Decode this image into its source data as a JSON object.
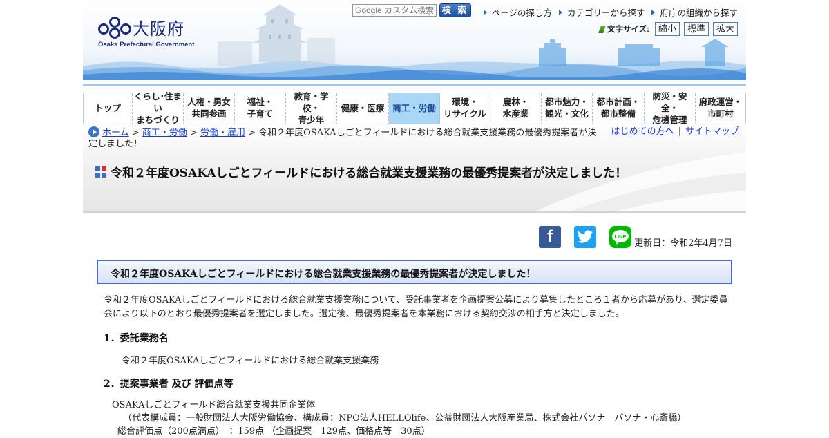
{
  "header": {
    "logo_text": "大阪府",
    "logo_sub": "Osaka Prefectural Government",
    "search_placeholder": "Google カスタム検索",
    "search_button": "検 索",
    "top_links": [
      "ページの探し方",
      "カテゴリーから探す",
      "府庁の組織から探す"
    ],
    "fontsize_label": "文字サイズ:",
    "fontsize_buttons": [
      "縮小",
      "標準",
      "拡大"
    ]
  },
  "nav": [
    {
      "label": "トップ",
      "active": false
    },
    {
      "label": "くらし･住まい\nまちづくり",
      "active": false
    },
    {
      "label": "人権・男女\n共同参画",
      "active": false
    },
    {
      "label": "福祉・\n子育て",
      "active": false
    },
    {
      "label": "教育・学校・\n青少年",
      "active": false
    },
    {
      "label": "健康・医療",
      "active": false
    },
    {
      "label": "商工・労働",
      "active": true
    },
    {
      "label": "環境・\nリサイクル",
      "active": false
    },
    {
      "label": "農林・\n水産業",
      "active": false
    },
    {
      "label": "都市魅力・\n観光・文化",
      "active": false
    },
    {
      "label": "都市計画・\n都市整備",
      "active": false
    },
    {
      "label": "防災・安全・\n危機管理",
      "active": false
    },
    {
      "label": "府政運営・\n市町村",
      "active": false
    }
  ],
  "breadcrumb": {
    "items": [
      "ホーム",
      "商工・労働",
      "労働・雇用"
    ],
    "current": "令和２年度OSAKAしごとフィールドにおける総合就業支援業務の最優秀提案者が決定しました！"
  },
  "util_links": [
    "はじめての方へ",
    "サイトマップ"
  ],
  "page_title": "令和２年度OSAKAしごとフィールドにおける総合就業支援業務の最優秀提案者が決定しました！",
  "social": {
    "line_label": "LINE"
  },
  "updated": "更新日：令和2年4月7日",
  "content": {
    "section_heading": "令和２年度OSAKAしごとフィールドにおける総合就業支援業務の最優秀提案者が決定しました！",
    "intro": "令和２年度OSAKAしごとフィールドにおける総合就業支援業務について、受託事業者を企画提案公募により募集したところ１者から応募があり、選定委員会により以下のとおり最優秀提案者を選定しました。選定後、最優秀提案者を本業務における契約交渉の相手方と決定しました。",
    "h1": "1．委託業務名",
    "task_name": "令和２年度OSAKAしごとフィールドにおける総合就業支援業務",
    "h2": "2．提案事業者 及び 評価点等",
    "bidder_name": "OSAKAしごとフィールド総合就業支援共同企業体",
    "bidder_members": "（代表構成員：一般財団法人大阪労働協会、構成員：NPO法人HELLOlife、公益財団法人大阪産業局、株式会社パソナ　パソナ・心斎橋）",
    "bidder_score": "総合評価点（200点満点）　：159点 （企画提案　129点、価格点等　30点）"
  },
  "colors": {
    "brand_blue": "#1b2b7a",
    "nav_active_bg": "#a9d7f5",
    "link": "#1a3cc8",
    "section_border": "#4a6fbf",
    "facebook": "#3a5997",
    "twitter": "#1da1f2",
    "line": "#00b900"
  },
  "icons": [
    "osaka-logo-icon",
    "castle-icon",
    "arrow-right-icon",
    "pen-icon",
    "home-icon",
    "title-square-icon",
    "facebook-icon",
    "twitter-icon",
    "line-icon"
  ]
}
